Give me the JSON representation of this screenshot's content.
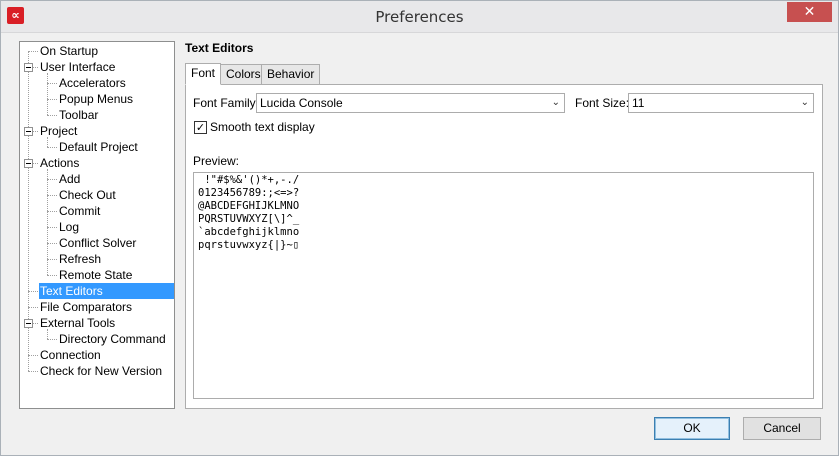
{
  "window": {
    "title": "Preferences",
    "app_icon": "app-logo-icon",
    "app_icon_glyph": "∝",
    "close_glyph": "✕"
  },
  "tree": {
    "items": [
      {
        "label": "On Startup",
        "level": 0
      },
      {
        "label": "User Interface",
        "level": 0,
        "expandable": true
      },
      {
        "label": "Accelerators",
        "level": 1
      },
      {
        "label": "Popup Menus",
        "level": 1
      },
      {
        "label": "Toolbar",
        "level": 1
      },
      {
        "label": "Project",
        "level": 0,
        "expandable": true
      },
      {
        "label": "Default Project",
        "level": 1
      },
      {
        "label": "Actions",
        "level": 0,
        "expandable": true
      },
      {
        "label": "Add",
        "level": 1
      },
      {
        "label": "Check Out",
        "level": 1
      },
      {
        "label": "Commit",
        "level": 1
      },
      {
        "label": "Log",
        "level": 1
      },
      {
        "label": "Conflict Solver",
        "level": 1
      },
      {
        "label": "Refresh",
        "level": 1
      },
      {
        "label": "Remote State",
        "level": 1
      },
      {
        "label": "Text Editors",
        "level": 0,
        "selected": true
      },
      {
        "label": "File Comparators",
        "level": 0
      },
      {
        "label": "External Tools",
        "level": 0,
        "expandable": true
      },
      {
        "label": "Directory Command",
        "level": 1
      },
      {
        "label": "Connection",
        "level": 0
      },
      {
        "label": "Check for New Version",
        "level": 0
      }
    ]
  },
  "panel": {
    "title": "Text Editors",
    "tabs": [
      "Font",
      "Colors",
      "Behavior"
    ],
    "active_tab": "Font",
    "font_family_label": "Font Family:",
    "font_family_value": "Lucida Console",
    "font_size_label": "Font Size:",
    "font_size_value": "11",
    "smooth_label": "Smooth text display",
    "smooth_checked": true,
    "check_glyph": "✓",
    "dropdown_glyph": "⌄",
    "preview_label": "Preview:",
    "preview_lines": [
      " !\"#$%&'()*+,-./",
      "0123456789:;<=>?",
      "@ABCDEFGHIJKLMNO",
      "PQRSTUVWXYZ[\\]^_",
      "`abcdefghijklmno",
      "pqrstuvwxyz{|}~▯"
    ]
  },
  "buttons": {
    "ok": "OK",
    "cancel": "Cancel"
  },
  "colors": {
    "selection": "#3399ff",
    "close": "#c75050",
    "app_icon": "#d91f26"
  }
}
